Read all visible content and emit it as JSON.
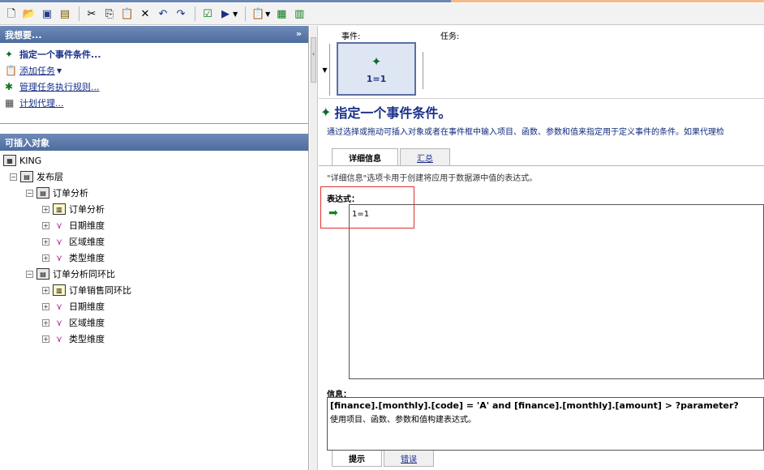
{
  "toolbar": {
    "icons": [
      "new-icon",
      "open-icon",
      "save-icon",
      "save-all-icon",
      "cut-icon",
      "copy-icon",
      "paste-icon",
      "delete-icon",
      "undo-icon",
      "redo-icon",
      "validate-icon",
      "run-icon",
      "properties-icon",
      "publish-icon",
      "report-icon"
    ]
  },
  "actions_panel": {
    "title": "我想要...",
    "items": [
      {
        "label": "指定一个事件条件...",
        "bold": true
      },
      {
        "label": "添加任务",
        "dropdown": true
      },
      {
        "label": "管理任务执行规则..."
      },
      {
        "label": "计划代理..."
      }
    ]
  },
  "objects_panel": {
    "title": "可插入对象",
    "tree": [
      {
        "label": "KING",
        "level": 0,
        "icon": "package"
      },
      {
        "label": "发布层",
        "level": 1,
        "icon": "folder",
        "exp": "−"
      },
      {
        "label": "订单分析",
        "level": 2,
        "icon": "folder",
        "exp": "−"
      },
      {
        "label": "订单分析",
        "level": 3,
        "icon": "table",
        "exp": "+"
      },
      {
        "label": "日期维度",
        "level": 3,
        "icon": "dimension",
        "exp": "+"
      },
      {
        "label": "区域维度",
        "level": 3,
        "icon": "dimension",
        "exp": "+"
      },
      {
        "label": "类型维度",
        "level": 3,
        "icon": "dimension",
        "exp": "+"
      },
      {
        "label": "订单分析同环比",
        "level": 2,
        "icon": "folder",
        "exp": "−"
      },
      {
        "label": "订单销售同环比",
        "level": 3,
        "icon": "table",
        "exp": "+"
      },
      {
        "label": "日期维度",
        "level": 3,
        "icon": "dimension",
        "exp": "+"
      },
      {
        "label": "区域维度",
        "level": 3,
        "icon": "dimension",
        "exp": "+"
      },
      {
        "label": "类型维度",
        "level": 3,
        "icon": "dimension",
        "exp": "+"
      }
    ]
  },
  "event_strip": {
    "event_label": "事件:",
    "task_label": "任务:",
    "event_condition": "1=1"
  },
  "main": {
    "title": "指定一个事件条件。",
    "description": "通过选择或拖动可插入对象或者在事件框中输入项目、函数、参数和值来指定用于定义事件的条件。如果代理检",
    "tabs": [
      {
        "label": "详细信息",
        "active": true
      },
      {
        "label": "汇总",
        "active": false
      }
    ],
    "tab_description": "\"详细信息\"选项卡用于创建将应用于数据源中值的表达式。",
    "expression_label": "表达式：",
    "expression_value": "1=1",
    "info_label": "信息：",
    "info_line1": "[finance].[monthly].[code] = 'A' and [finance].[monthly].[amount] > ?parameter?",
    "info_line2": "使用项目、函数、参数和值构建表达式。",
    "bottom_tabs": [
      {
        "label": "提示",
        "active": true
      },
      {
        "label": "错误",
        "active": false
      }
    ]
  }
}
